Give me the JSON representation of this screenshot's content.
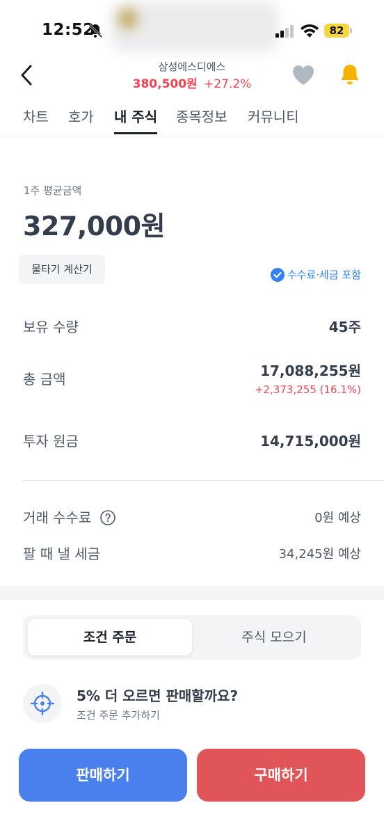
{
  "status_bar": {
    "time": "12:52",
    "battery": "82",
    "icons": [
      "bell-slash-icon",
      "signal-icon",
      "wifi-icon",
      "battery-icon"
    ]
  },
  "header": {
    "stock_name": "삼성에스디에스",
    "price": "380,500원",
    "change": "+27.2%",
    "icons": [
      "back-icon",
      "heart-icon",
      "bell-icon"
    ]
  },
  "tabs": [
    {
      "label": "차트"
    },
    {
      "label": "호가"
    },
    {
      "label": "내 주식",
      "active": true
    },
    {
      "label": "종목정보"
    },
    {
      "label": "커뮤니티"
    }
  ],
  "summary": {
    "avg_label": "1주 평균금액",
    "avg_value": "327,000원",
    "calc_button": "물타기 계산기",
    "fee_included": "수수료·세금 포함"
  },
  "holdings": {
    "quantity_label": "보유 수량",
    "quantity_value": "45주",
    "total_label": "총 금액",
    "total_value": "17,088,255원",
    "total_change": "+2,373,255 (16.1%)",
    "principal_label": "투자 원금",
    "principal_value": "14,715,000원"
  },
  "costs": {
    "fee_label": "거래 수수료",
    "fee_value": "0원 예상",
    "tax_label": "팔 때 낼 세금",
    "tax_value": "34,245원 예상"
  },
  "order_tabs": {
    "active": "조건 주문",
    "inactive": "주식 모으기"
  },
  "suggestion": {
    "title": "5% 더 오르면 판매할까요?",
    "subtitle": "조건 주문 추가하기"
  },
  "actions": {
    "sell": "판매하기",
    "buy": "구매하기"
  },
  "colors": {
    "red": "#f04452",
    "blue": "#3182f6",
    "sell_button": "#4a80ed",
    "buy_button": "#e05557",
    "bell": "#f5b300",
    "heart": "#b0b8c1"
  }
}
